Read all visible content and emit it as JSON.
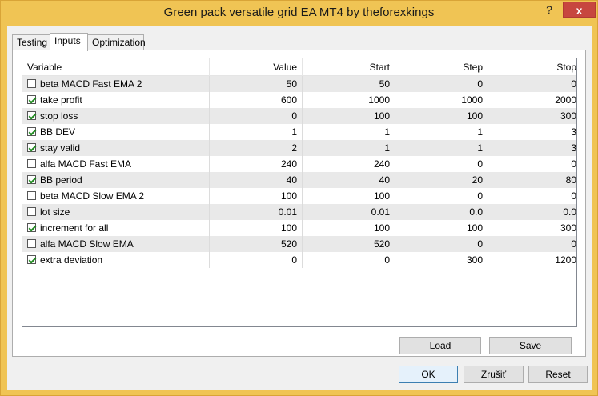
{
  "window": {
    "title": "Green pack versatile grid EA MT4 by theforexkings",
    "help_glyph": "?",
    "close_glyph": "x"
  },
  "tabs": [
    {
      "label": "Testing"
    },
    {
      "label": "Inputs"
    },
    {
      "label": "Optimization"
    }
  ],
  "grid": {
    "columns": [
      "Variable",
      "Value",
      "Start",
      "Step",
      "Stop"
    ],
    "rows": [
      {
        "checked": false,
        "name": "beta MACD Fast EMA 2",
        "value": "50",
        "start": "50",
        "step": "0",
        "stop": "0"
      },
      {
        "checked": true,
        "name": "take profit",
        "value": "600",
        "start": "1000",
        "step": "1000",
        "stop": "2000"
      },
      {
        "checked": true,
        "name": "stop loss",
        "value": "0",
        "start": "100",
        "step": "100",
        "stop": "300"
      },
      {
        "checked": true,
        "name": "BB DEV",
        "value": "1",
        "start": "1",
        "step": "1",
        "stop": "3"
      },
      {
        "checked": true,
        "name": "stay valid",
        "value": "2",
        "start": "1",
        "step": "1",
        "stop": "3"
      },
      {
        "checked": false,
        "name": "alfa MACD Fast EMA",
        "value": "240",
        "start": "240",
        "step": "0",
        "stop": "0"
      },
      {
        "checked": true,
        "name": "BB period",
        "value": "40",
        "start": "40",
        "step": "20",
        "stop": "80"
      },
      {
        "checked": false,
        "name": "beta MACD Slow EMA 2",
        "value": "100",
        "start": "100",
        "step": "0",
        "stop": "0"
      },
      {
        "checked": false,
        "name": "lot size",
        "value": "0.01",
        "start": "0.01",
        "step": "0.0",
        "stop": "0.0"
      },
      {
        "checked": true,
        "name": "increment for all",
        "value": "100",
        "start": "100",
        "step": "100",
        "stop": "300"
      },
      {
        "checked": false,
        "name": "alfa MACD Slow EMA",
        "value": "520",
        "start": "520",
        "step": "0",
        "stop": "0"
      },
      {
        "checked": true,
        "name": "extra deviation",
        "value": "0",
        "start": "0",
        "step": "300",
        "stop": "1200"
      }
    ]
  },
  "buttons": {
    "load": "Load",
    "save": "Save",
    "ok": "OK",
    "cancel": "Zrušiť",
    "reset": "Reset"
  }
}
